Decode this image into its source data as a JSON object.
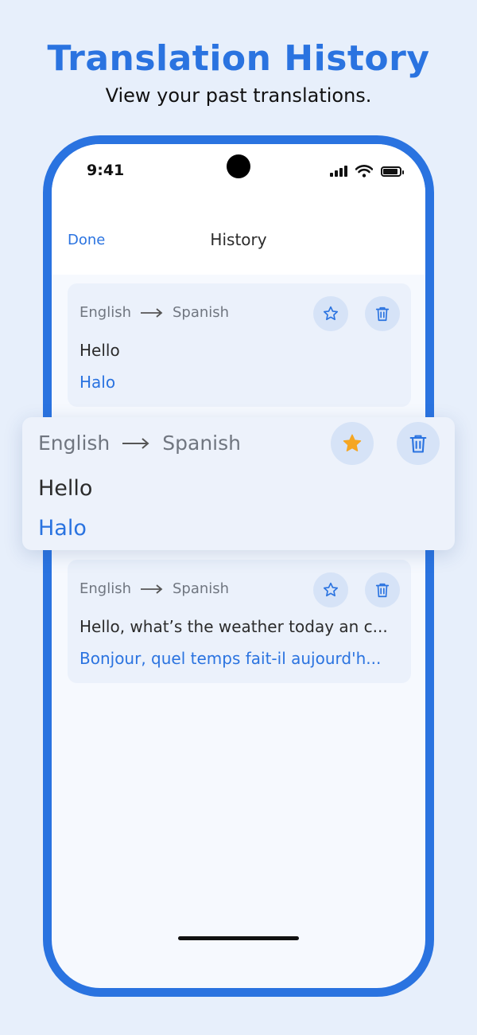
{
  "header": {
    "title": "Translation History",
    "subtitle": "View your past translations."
  },
  "status_bar": {
    "time": "9:41",
    "icons": [
      "signal-icon",
      "wifi-icon",
      "battery-icon"
    ]
  },
  "nav": {
    "done_label": "Done",
    "title": "History"
  },
  "colors": {
    "accent": "#2a73e0",
    "star_active": "#f5a623",
    "card_bg": "#ebf1fb",
    "icon_button_bg": "#d6e3f7"
  },
  "history": [
    {
      "source_lang": "English",
      "target_lang": "Spanish",
      "source_text": "Hello",
      "translated_text": "Halo",
      "favorited": false
    },
    {
      "source_lang": "English",
      "target_lang": "Spanish",
      "source_text": "Hello",
      "translated_text": "Halo",
      "favorited": true,
      "expanded": true
    },
    {
      "source_lang": "English",
      "target_lang": "Spanish",
      "source_text": "Hello, what’s the weather today an c...",
      "translated_text": "Bonjour, quel temps fait-il aujourd'h...",
      "favorited": false
    }
  ]
}
